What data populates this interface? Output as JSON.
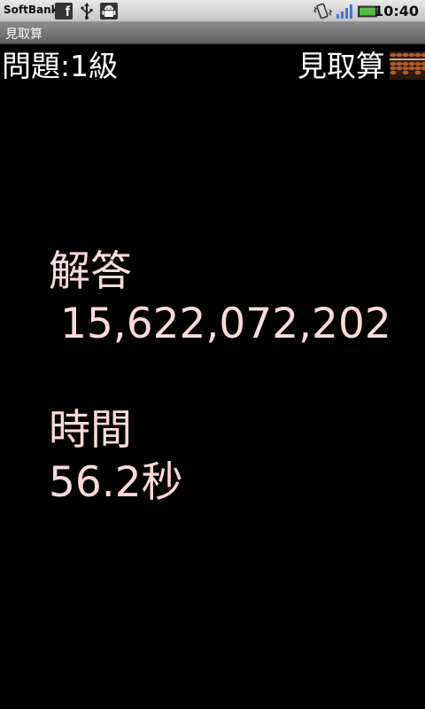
{
  "status_bar": {
    "carrier": "SoftBank",
    "time": "10:40",
    "icons": [
      "facebook-icon",
      "usb-icon",
      "android-debug-icon",
      "vibrate-icon",
      "signal-icon",
      "battery-icon"
    ],
    "facebook_glyph": "f"
  },
  "title_bar": {
    "title": "見取算"
  },
  "header": {
    "level": "問題:1級",
    "mode": "見取算",
    "mode_icon": "abacus-icon"
  },
  "result": {
    "answer_label": "解答",
    "answer_value": "15,622,072,202",
    "time_label": "時間",
    "time_value": "56.2秒"
  },
  "colors": {
    "background": "#000000",
    "result_text": "#ffd9d9",
    "header_text": "#ffffff"
  }
}
